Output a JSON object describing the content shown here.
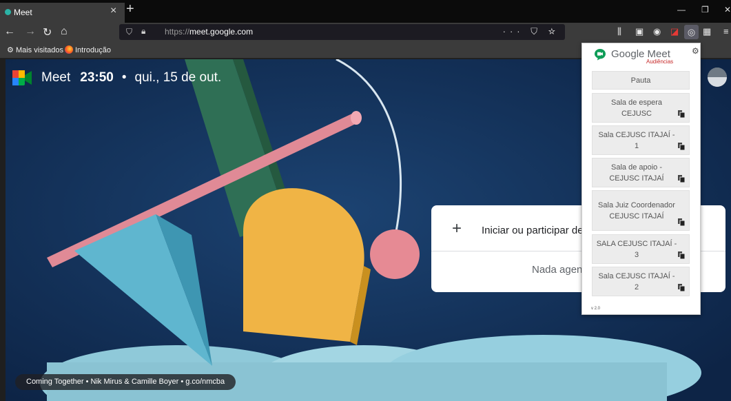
{
  "browser": {
    "tab_title": "Meet",
    "tab_close": "×",
    "new_tab": "+",
    "win_minimize": "—",
    "win_restore": "❐",
    "win_close": "✕",
    "url_prefix": "https://",
    "url_domain": "meet.google.com",
    "url_actions": "··· ⛉ ☆",
    "bookmarks": [
      {
        "label": "Mais visitados",
        "icon": "gear-icon"
      },
      {
        "label": "Introdução",
        "icon": "firefox-icon"
      }
    ]
  },
  "meet": {
    "title": "Meet",
    "time": "23:50",
    "separator": "•",
    "date": "qui., 15 de out.",
    "join_label": "Iniciar ou participar de",
    "nothing_scheduled": "Nada agen",
    "credits": "Coming Together  •  Nik Mirus & Camille Boyer  •  g.co/nmcba"
  },
  "popup": {
    "title": "Google Meet",
    "subtitle": "Audiências",
    "items": [
      {
        "label": "Pauta",
        "copy": false
      },
      {
        "label": "Sala de espera CEJUSC",
        "copy": true
      },
      {
        "label": "Sala CEJUSC ITAJAÍ - 1",
        "copy": true
      },
      {
        "label": "Sala de apoio - CEJUSC ITAJAÍ",
        "copy": true
      },
      {
        "label": "Sala Juiz Coordenador CEJUSC ITAJAÍ",
        "copy": true
      },
      {
        "label": "SALA CEJUSC ITAJAÍ - 3",
        "copy": true
      },
      {
        "label": "Sala CEJUSC ITAJAÍ - 2",
        "copy": true
      }
    ],
    "version": "v 2.0"
  },
  "colors": {
    "page_bg": "#12305a",
    "subtitle_red": "#c62828"
  }
}
